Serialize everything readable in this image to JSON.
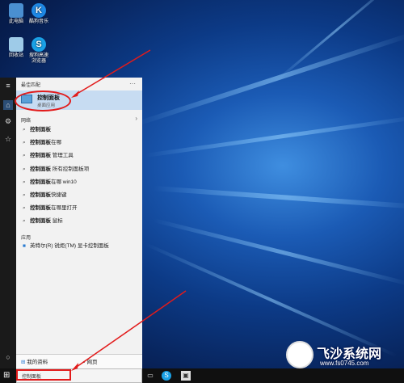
{
  "desktop_icons": [
    {
      "label": "此电脑",
      "color": "#4a8fd1"
    },
    {
      "label": "酷狗音乐",
      "color": "#1e88e5"
    },
    {
      "label": "回收站",
      "color": "#9ecbe8"
    },
    {
      "label": "搜狗高速\n浏览器",
      "color": "#1aa1e6"
    }
  ],
  "start_menu": {
    "best_match_header": "最佳匹配",
    "more_icon": "more-dots-icon",
    "best_match": {
      "title": "控制面板",
      "subtitle": "桌面应用"
    },
    "web_header": "网络",
    "web_results": [
      {
        "bold": "控制面板",
        "rest": ""
      },
      {
        "bold": "控制面板",
        "rest": "在哪"
      },
      {
        "bold": "控制面板",
        "rest": " 管理工具"
      },
      {
        "bold": "控制面板",
        "rest": " 所有控制面板项"
      },
      {
        "bold": "控制面板",
        "rest": "在哪 win10"
      },
      {
        "bold": "控制面板",
        "rest": "快捷键"
      },
      {
        "bold": "控制面板",
        "rest": "在哪里打开"
      },
      {
        "bold": "控制面板",
        "rest": " 鼠标"
      }
    ],
    "apps_header": "应用",
    "apps": [
      {
        "label": "英特尔(R) 锐炬(TM) 显卡控制面板"
      }
    ],
    "bottom": {
      "my_stuff": "我的资料",
      "web": "网页"
    }
  },
  "taskbar": {
    "search_value": "控制面板"
  },
  "watermark": {
    "title": "飞沙系统网",
    "url": "www.fs0745.com"
  },
  "colors": {
    "annotation": "#e21b1b",
    "best_match_bg": "#c7dcf2"
  }
}
